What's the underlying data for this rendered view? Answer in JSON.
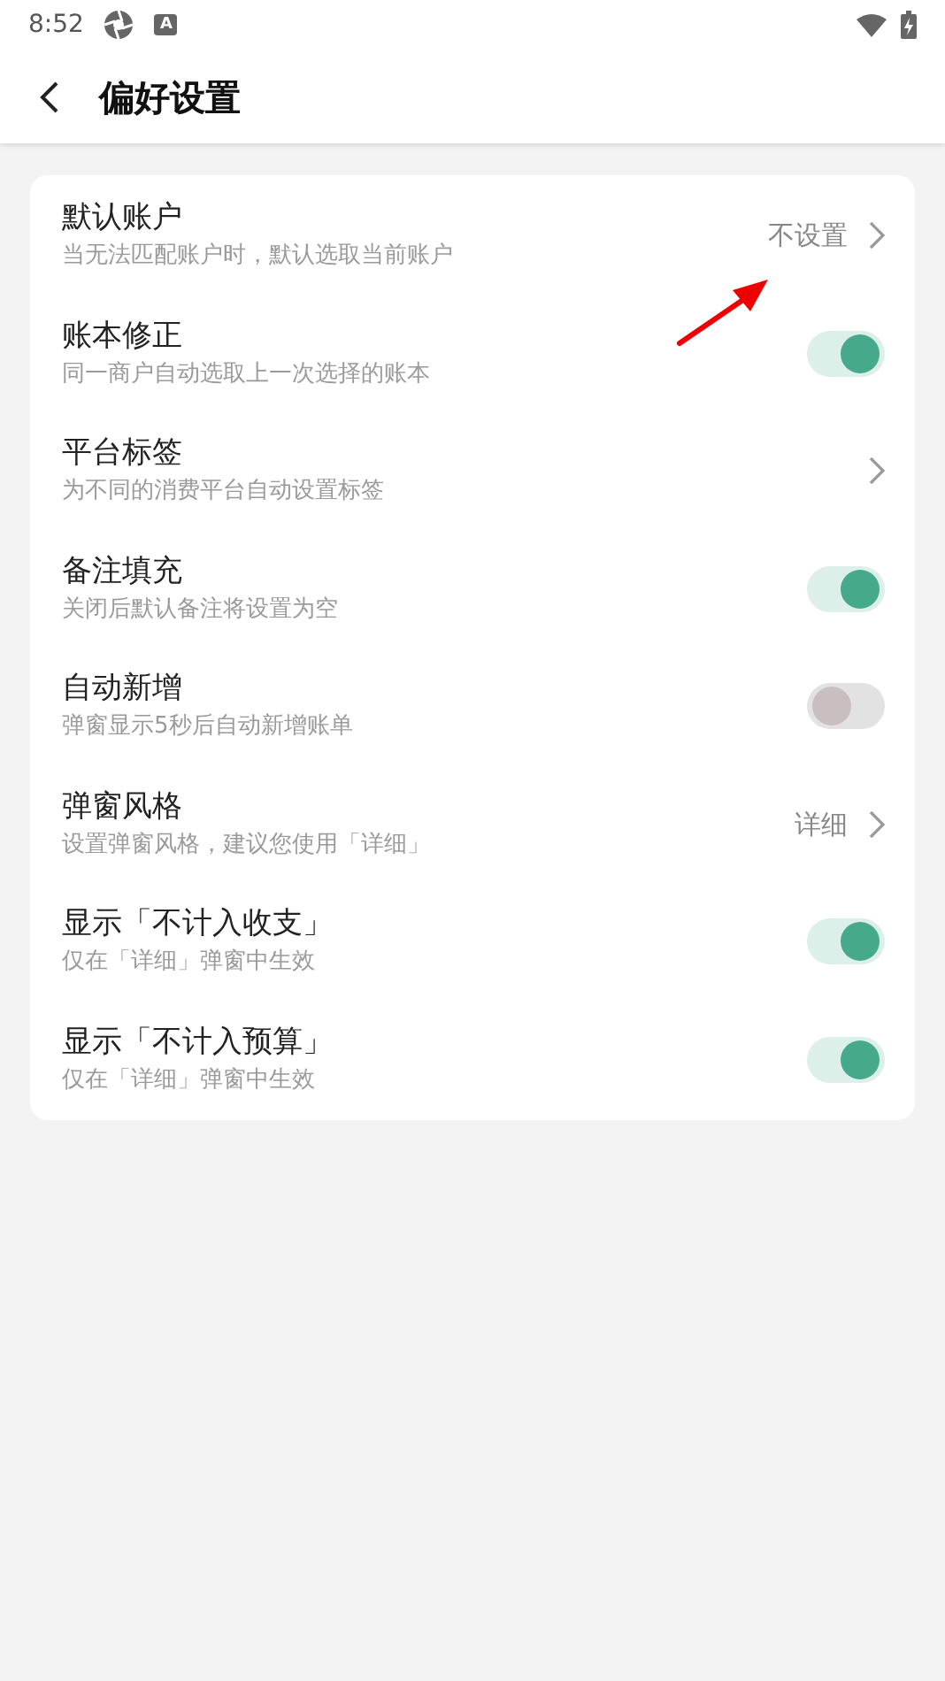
{
  "status_bar": {
    "time": "8:52",
    "badge": "A"
  },
  "app_bar": {
    "title": "偏好设置"
  },
  "settings": [
    {
      "kind": "link",
      "title": "默认账户",
      "subtitle": "当无法匹配账户时，默认选取当前账户",
      "value": "不设置"
    },
    {
      "kind": "switch",
      "title": "账本修正",
      "subtitle": "同一商户自动选取上一次选择的账本",
      "on": true
    },
    {
      "kind": "link",
      "title": "平台标签",
      "subtitle": "为不同的消费平台自动设置标签"
    },
    {
      "kind": "switch",
      "title": "备注填充",
      "subtitle": "关闭后默认备注将设置为空",
      "on": true
    },
    {
      "kind": "switch",
      "title": "自动新增",
      "subtitle": "弹窗显示5秒后自动新增账单",
      "on": false
    },
    {
      "kind": "link",
      "title": "弹窗风格",
      "subtitle": "设置弹窗风格，建议您使用「详细」",
      "value": "详细"
    },
    {
      "kind": "switch",
      "title": "显示「不计入收支」",
      "subtitle": "仅在「详细」弹窗中生效",
      "on": true
    },
    {
      "kind": "switch",
      "title": "显示「不计入预算」",
      "subtitle": "仅在「详细」弹窗中生效",
      "on": true
    }
  ]
}
